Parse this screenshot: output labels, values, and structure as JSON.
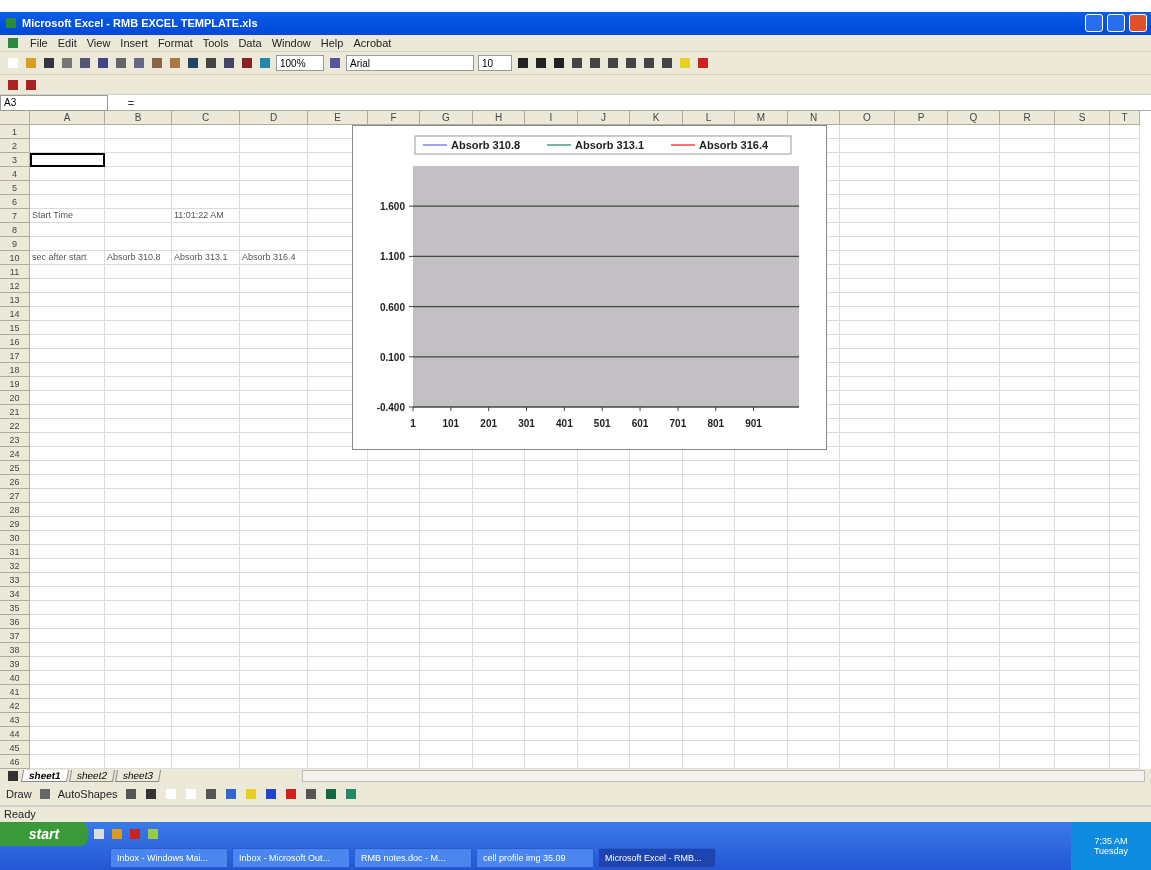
{
  "window": {
    "title": "Microsoft Excel - RMB EXCEL TEMPLATE.xls"
  },
  "menu": [
    "File",
    "Edit",
    "View",
    "Insert",
    "Format",
    "Tools",
    "Data",
    "Window",
    "Help",
    "Acrobat"
  ],
  "toolbar": {
    "zoom": "100%",
    "font": "Arial",
    "font_size": "10"
  },
  "formula_bar": {
    "name_box": "A3",
    "fx": "="
  },
  "columns": [
    "A",
    "B",
    "C",
    "D",
    "E",
    "F",
    "G",
    "H",
    "I",
    "J",
    "K",
    "L",
    "M",
    "N",
    "O",
    "P",
    "Q",
    "R",
    "S",
    "T"
  ],
  "rows": [
    {
      "number": "1"
    },
    {
      "number": "2"
    },
    {
      "number": "3",
      "cells": [
        {
          "selected": true
        }
      ]
    },
    {
      "number": "4"
    },
    {
      "number": "5"
    },
    {
      "number": "6"
    },
    {
      "number": "7",
      "cells": [
        {
          "text": "Start Time"
        },
        {},
        {
          "text": "11:01:22 AM"
        }
      ]
    },
    {
      "number": "8"
    },
    {
      "number": "9"
    },
    {
      "number": "10",
      "cells": [
        {
          "text": "sec after start"
        },
        {
          "text": "Absorb 310.8"
        },
        {
          "text": "Absorb 313.1"
        },
        {
          "text": "Absorb 316.4"
        }
      ]
    },
    {
      "number": "11"
    },
    {
      "number": "12"
    },
    {
      "number": "13"
    },
    {
      "number": "14"
    },
    {
      "number": "15"
    },
    {
      "number": "16"
    },
    {
      "number": "17"
    },
    {
      "number": "18"
    },
    {
      "number": "19"
    },
    {
      "number": "20"
    },
    {
      "number": "21"
    },
    {
      "number": "22"
    },
    {
      "number": "23"
    },
    {
      "number": "24"
    },
    {
      "number": "25"
    },
    {
      "number": "26"
    },
    {
      "number": "27"
    },
    {
      "number": "28"
    },
    {
      "number": "29"
    },
    {
      "number": "30"
    },
    {
      "number": "31"
    },
    {
      "number": "32"
    },
    {
      "number": "33"
    },
    {
      "number": "34"
    },
    {
      "number": "35"
    },
    {
      "number": "36"
    },
    {
      "number": "37"
    },
    {
      "number": "38"
    },
    {
      "number": "39"
    },
    {
      "number": "40"
    },
    {
      "number": "41"
    },
    {
      "number": "42"
    },
    {
      "number": "43"
    },
    {
      "number": "44"
    },
    {
      "number": "45"
    },
    {
      "number": "46"
    }
  ],
  "chart": {
    "chart_data": {
      "type": "line",
      "series": [
        {
          "name": "Absorb 310.8",
          "color": "#8080ff",
          "values": [
            null,
            null,
            null,
            null,
            null,
            null,
            null,
            null,
            null,
            null
          ]
        },
        {
          "name": "Absorb 313.1",
          "color": "#40a080",
          "values": [
            null,
            null,
            null,
            null,
            null,
            null,
            null,
            null,
            null,
            null
          ]
        },
        {
          "name": "Absorb 316.4",
          "color": "#ff4040",
          "values": [
            null,
            null,
            null,
            null,
            null,
            null,
            null,
            null,
            null,
            null
          ]
        }
      ],
      "ylim": [
        -0.4,
        2.0
      ],
      "yticks": [
        {
          "value": -0.4,
          "label": "-0.400"
        },
        {
          "value": 0.1,
          "label": "0.100"
        },
        {
          "value": 0.6,
          "label": "0.600"
        },
        {
          "value": 1.1,
          "label": "1.100"
        },
        {
          "value": 1.6,
          "label": "1.600"
        }
      ],
      "categories": [
        "1",
        "101",
        "201",
        "301",
        "401",
        "501",
        "601",
        "701",
        "801",
        "901"
      ],
      "grid": true
    }
  },
  "sheet_tabs": [
    {
      "label": "sheet1",
      "selected": true
    },
    {
      "label": "sheet2",
      "selected": false
    },
    {
      "label": "sheet3",
      "selected": false
    }
  ],
  "drawing_toolbar": {
    "draw": "Draw",
    "autoshapes": "AutoShapes"
  },
  "status_bar": "Ready",
  "taskbar": {
    "start": "start",
    "tasks": [
      {
        "label": "Inbox - Windows Mai...",
        "selected": false
      },
      {
        "label": "Inbox - Microsoft Out...",
        "selected": false
      },
      {
        "label": "RMB notes.doc - M...",
        "selected": false
      },
      {
        "label": "cell profile img 35.09",
        "selected": false
      },
      {
        "label": "Microsoft Excel - RMB...",
        "selected": true
      }
    ],
    "clock": [
      "7:35 AM",
      "Tuesday"
    ]
  }
}
